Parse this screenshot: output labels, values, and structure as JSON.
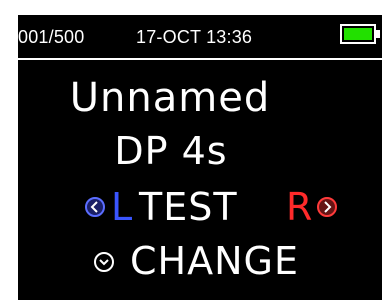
{
  "status_bar": {
    "record_counter": "001/500",
    "datetime": "17-OCT 13:36",
    "battery_color": "#22e000",
    "battery_level": 1.0
  },
  "main": {
    "patient_name": "Unnamed",
    "protocol": "DP 4s",
    "test": {
      "left_ear": "L",
      "label": "TEST",
      "right_ear": "R"
    },
    "change_label": "CHANGE"
  },
  "colors": {
    "background": "#000000",
    "text": "#ffffff",
    "left_ear": "#3a55ff",
    "right_ear": "#ff2a2a"
  },
  "icons": {
    "left_nav": "chevron-left-icon",
    "right_nav": "chevron-right-icon",
    "change": "chevron-down-icon"
  }
}
